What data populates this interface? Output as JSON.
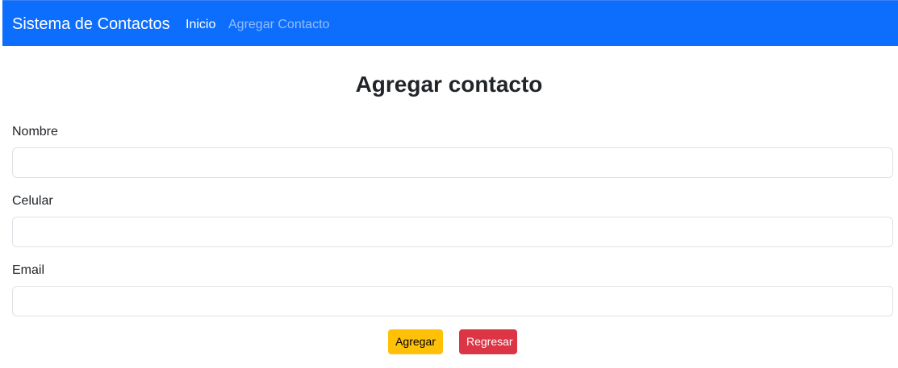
{
  "navbar": {
    "brand": "Sistema de Contactos",
    "links": [
      {
        "label": "Inicio",
        "active": true
      },
      {
        "label": "Agregar Contacto",
        "active": false
      }
    ],
    "color": "#0d6efd"
  },
  "page": {
    "title": "Agregar contacto"
  },
  "form": {
    "fields": [
      {
        "label": "Nombre",
        "value": "",
        "placeholder": ""
      },
      {
        "label": "Celular",
        "value": "",
        "placeholder": ""
      },
      {
        "label": "Email",
        "value": "",
        "placeholder": ""
      }
    ],
    "buttons": {
      "add": {
        "label": "Agregar",
        "color": "#ffc107"
      },
      "back": {
        "label": "Regresar",
        "color": "#dc3545"
      }
    }
  }
}
